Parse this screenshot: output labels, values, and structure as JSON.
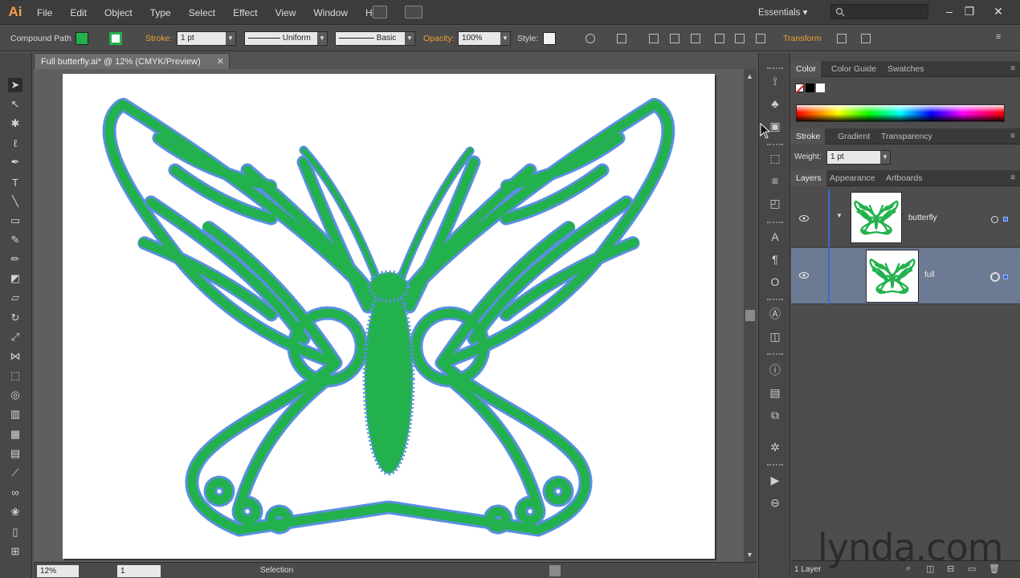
{
  "app": {
    "logo": "Ai",
    "workspace": "Essentials"
  },
  "menu": [
    "File",
    "Edit",
    "Object",
    "Type",
    "Select",
    "Effect",
    "View",
    "Window",
    "Help"
  ],
  "control_bar": {
    "object_type": "Compound Path",
    "stroke_label": "Stroke:",
    "stroke_weight": "1 pt",
    "variable_width": "Uniform",
    "brush": "Basic",
    "opacity_label": "Opacity:",
    "opacity_value": "100%",
    "style_label": "Style:",
    "transform_label": "Transform",
    "fill_color": "#22b14c"
  },
  "document_tab": {
    "title": "Full butterfly.ai* @ 12% (CMYK/Preview)",
    "close": "✕"
  },
  "status_bar": {
    "zoom": "12%",
    "artboard": "1",
    "tool": "Selection"
  },
  "panels": {
    "color_tabs": [
      "Color",
      "Color Guide",
      "Swatches"
    ],
    "stroke_tabs": [
      "Stroke",
      "Gradient",
      "Transparency"
    ],
    "stroke_weight_label": "Weight:",
    "stroke_weight_value": "1 pt",
    "layers_tabs": [
      "Layers",
      "Appearance",
      "Artboards"
    ],
    "layers": [
      {
        "name": "butterfly"
      },
      {
        "name": "full"
      }
    ],
    "footer_count": "1 Layer"
  },
  "watermark": "lynda.com",
  "colors": {
    "butterfly_fill": "#22b14c",
    "path_outline": "#5a8fe0",
    "selection": "#3a6bd6"
  }
}
